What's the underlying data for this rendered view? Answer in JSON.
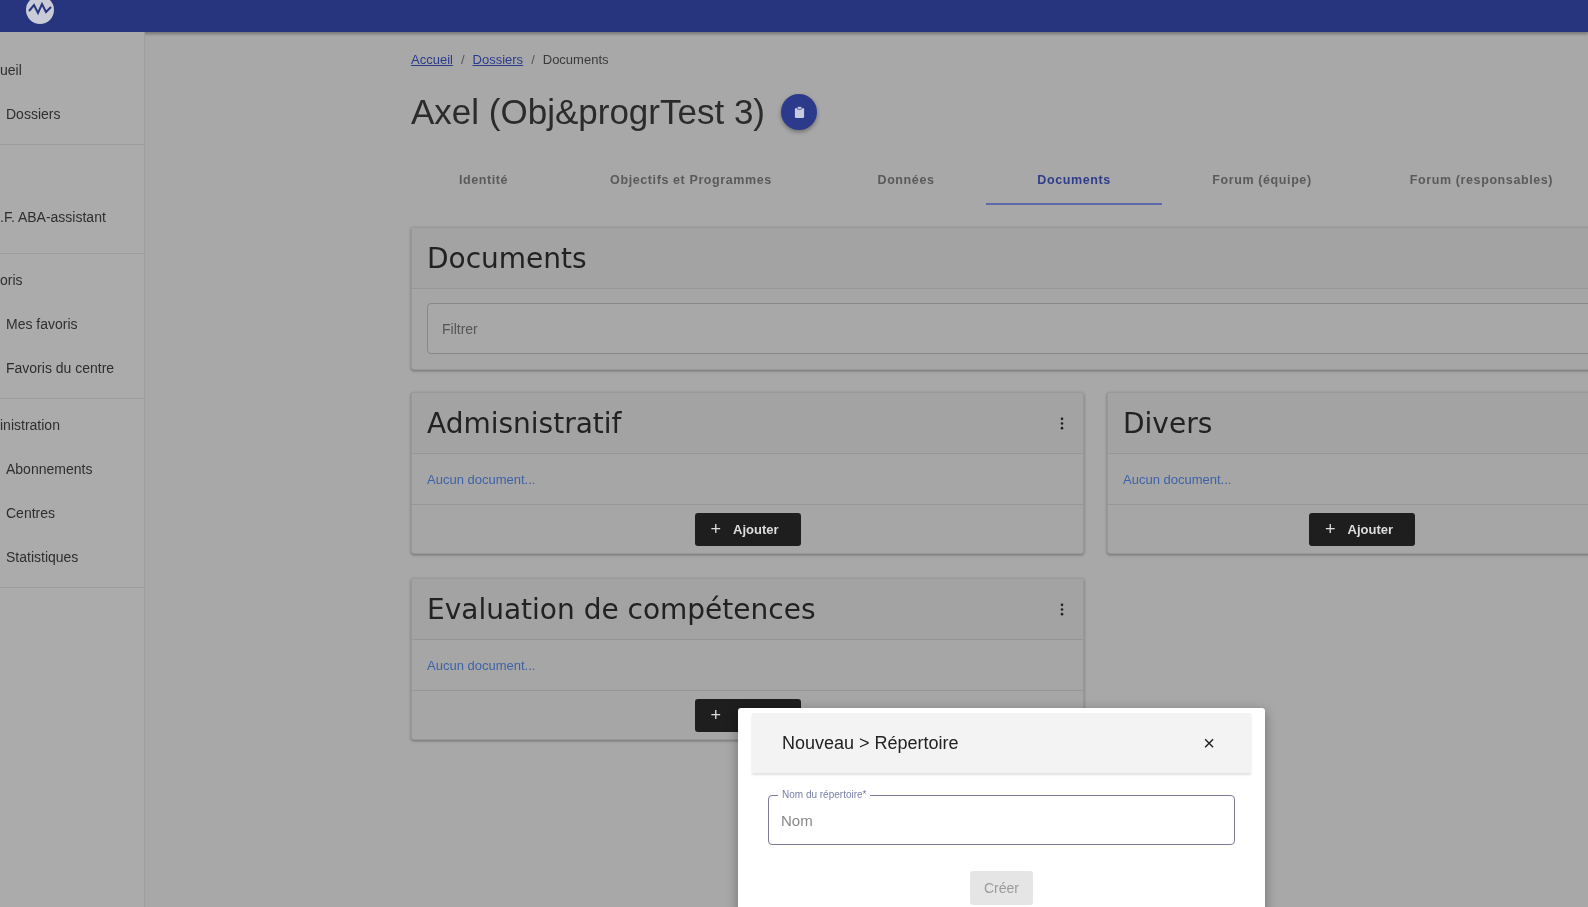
{
  "sidebar": {
    "groups": [
      {
        "items": [
          {
            "label": "ueil",
            "kind": "top"
          },
          {
            "label": "Dossiers",
            "kind": "sub"
          }
        ]
      },
      {
        "items": [
          {
            "label": ".F. ABA-assistant",
            "kind": "top"
          }
        ]
      },
      {
        "items": [
          {
            "label": "oris",
            "kind": "top"
          },
          {
            "label": "Mes favoris",
            "kind": "sub"
          },
          {
            "label": "Favoris du centre",
            "kind": "sub"
          }
        ]
      },
      {
        "items": [
          {
            "label": "inistration",
            "kind": "top"
          },
          {
            "label": "Abonnements",
            "kind": "sub"
          },
          {
            "label": "Centres",
            "kind": "sub"
          },
          {
            "label": "Statistiques",
            "kind": "sub"
          }
        ]
      }
    ]
  },
  "breadcrumb": [
    {
      "label": "Accueil",
      "link": true
    },
    {
      "label": "Dossiers",
      "link": true
    },
    {
      "label": "Documents",
      "link": false
    }
  ],
  "breadcrumb_separator": "/",
  "title": "Axel (Obj&progrTest 3)",
  "tabs": [
    {
      "label": "Identité",
      "selected": false
    },
    {
      "label": "Objectifs et Programmes",
      "selected": false
    },
    {
      "label": "Données",
      "selected": false
    },
    {
      "label": "Documents",
      "selected": true
    },
    {
      "label": "Forum (équipe)",
      "selected": false
    },
    {
      "label": "Forum (responsables)",
      "selected": false
    }
  ],
  "documents_panel": {
    "title": "Documents",
    "filter_placeholder": "Filtrer"
  },
  "folders": [
    {
      "title": "Admisnistratif",
      "menu": true,
      "empty_text": "Aucun document...",
      "button": {
        "icon": "+",
        "label": "Ajouter"
      }
    },
    {
      "title": "Divers",
      "empty_text": "Aucun document...",
      "button": {
        "icon": "+",
        "label": "Ajouter"
      }
    },
    {
      "title": "Evaluation de compétences",
      "menu": true,
      "empty_text": "Aucun document...",
      "button": {
        "icon": "+"
      }
    }
  ],
  "dialog": {
    "title": "Nouveau > Répertoire",
    "close": "×",
    "field_label": "Nom du répertoire*",
    "field_placeholder": "Nom",
    "submit": {
      "label": "Créer",
      "disabled": true
    }
  }
}
